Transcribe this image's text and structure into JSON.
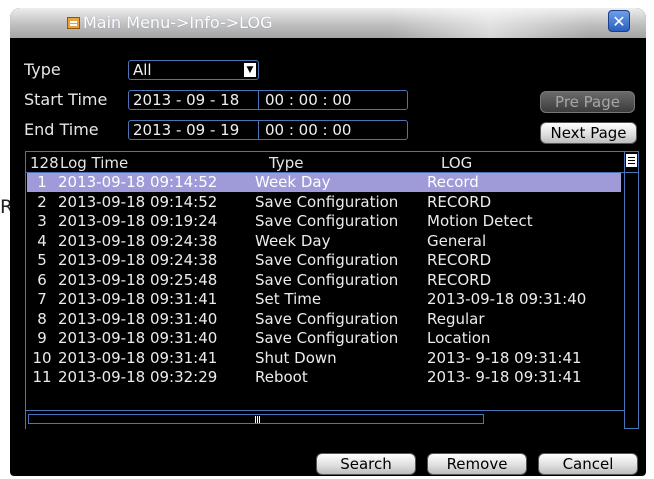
{
  "ghost_text": "R",
  "window": {
    "title": "Main Menu->Info->LOG",
    "close_label": "✕"
  },
  "filters": {
    "type_label": "Type",
    "type_value": "All",
    "dropdown_arrow": "▼",
    "start_label": "Start Time",
    "start_date": "2013 - 09 - 18",
    "start_time": "00 : 00 : 00",
    "end_label": "End Time",
    "end_date": "2013 - 09 - 19",
    "end_time": "00 : 00 : 00"
  },
  "paging": {
    "pre_page": "Pre Page",
    "next_page": "Next Page"
  },
  "table": {
    "count": "128",
    "headers": {
      "time": "Log Time",
      "type": "Type",
      "log": "LOG"
    },
    "rows": [
      {
        "no": "1",
        "time": "2013-09-18 09:14:52",
        "type": "Week Day",
        "log": "Record"
      },
      {
        "no": "2",
        "time": "2013-09-18 09:14:52",
        "type": "Save Configuration",
        "log": "RECORD"
      },
      {
        "no": "3",
        "time": "2013-09-18 09:19:24",
        "type": "Save Configuration",
        "log": "Motion Detect"
      },
      {
        "no": "4",
        "time": "2013-09-18 09:24:38",
        "type": "Week Day",
        "log": "General"
      },
      {
        "no": "5",
        "time": "2013-09-18 09:24:38",
        "type": "Save Configuration",
        "log": "RECORD"
      },
      {
        "no": "6",
        "time": "2013-09-18 09:25:48",
        "type": "Save Configuration",
        "log": "RECORD"
      },
      {
        "no": "7",
        "time": "2013-09-18 09:31:41",
        "type": "Set Time",
        "log": "2013-09-18 09:31:40"
      },
      {
        "no": "8",
        "time": "2013-09-18 09:31:40",
        "type": "Save Configuration",
        "log": "Regular"
      },
      {
        "no": "9",
        "time": "2013-09-18 09:31:40",
        "type": "Save Configuration",
        "log": "Location"
      },
      {
        "no": "10",
        "time": "2013-09-18 09:31:41",
        "type": "Shut Down",
        "log": "2013- 9-18 09:31:41"
      },
      {
        "no": "11",
        "time": "2013-09-18 09:32:29",
        "type": "Reboot",
        "log": "2013- 9-18 09:31:41"
      }
    ]
  },
  "actions": {
    "search": "Search",
    "remove": "Remove",
    "cancel": "Cancel"
  },
  "colors": {
    "selected_row": "#9f9ad8",
    "border_blue": "#4a74b6",
    "background": "#000000"
  }
}
